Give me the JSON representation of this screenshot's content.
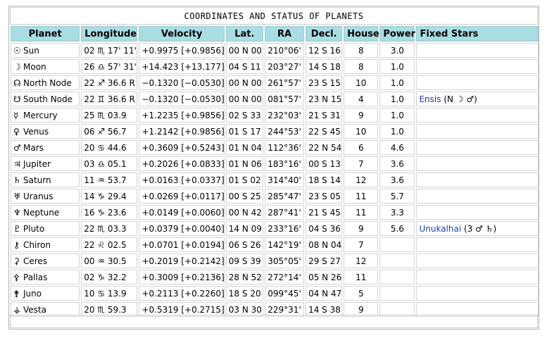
{
  "title": "COORDINATES AND STATUS OF PLANETS",
  "headers": [
    "Planet",
    "Longitude",
    "Velocity",
    "Lat.",
    "RA",
    "Decl.",
    "House",
    "Power",
    "Fixed Stars"
  ],
  "rows": [
    {
      "glyph": "☉",
      "name": "Sun",
      "lon": "02 ♏ 17' 11\"",
      "vel": "+0.9975  [+0.9856]",
      "lat": "00 N 00",
      "ra": "210°06'",
      "decl": "12 S 16",
      "house": "8",
      "power": "3.0",
      "star": "",
      "star_detail": ""
    },
    {
      "glyph": "☽",
      "name": "Moon",
      "lon": "26 ♎ 57' 31\"",
      "vel": "+14.423  [+13.177]",
      "lat": "04 S 11",
      "ra": "203°27'",
      "decl": "14 S 18",
      "house": "8",
      "power": "1.0",
      "star": "",
      "star_detail": ""
    },
    {
      "glyph": "☊",
      "name": "North Node",
      "lon": "22 ♐ 36.6  R",
      "vel": "−0.1320  [−0.0530]",
      "lat": "00 N 00",
      "ra": "261°57'",
      "decl": "23 S 15",
      "house": "10",
      "power": "1.0",
      "star": "",
      "star_detail": ""
    },
    {
      "glyph": "☋",
      "name": "South Node",
      "lon": "22 ♊ 36.6  R",
      "vel": "−0.1320  [−0.0530]",
      "lat": "00 N 00",
      "ra": "081°57'",
      "decl": "23 N 15",
      "house": "4",
      "power": "1.0",
      "star": "Ensis",
      "star_detail": " (N ☽ ♂)"
    },
    {
      "glyph": "☿",
      "name": "Mercury",
      "lon": "25 ♏ 03.9",
      "vel": "+1.2235  [+0.9856]",
      "lat": "02 S 33",
      "ra": "232°03'",
      "decl": "21 S 31",
      "house": "9",
      "power": "1.0",
      "star": "",
      "star_detail": ""
    },
    {
      "glyph": "♀",
      "name": "Venus",
      "lon": "06 ♐ 56.7",
      "vel": "+1.2142  [+0.9856]",
      "lat": "01 S 17",
      "ra": "244°53'",
      "decl": "22 S 45",
      "house": "10",
      "power": "1.0",
      "star": "",
      "star_detail": ""
    },
    {
      "glyph": "♂",
      "name": "Mars",
      "lon": "20 ♋ 44.6",
      "vel": "+0.3609  [+0.5243]",
      "lat": "01 N 04",
      "ra": "112°36'",
      "decl": "22 N 54",
      "house": "6",
      "power": "4.6",
      "star": "",
      "star_detail": ""
    },
    {
      "glyph": "♃",
      "name": "Jupiter",
      "lon": "03 ♎ 05.1",
      "vel": "+0.2026  [+0.0833]",
      "lat": "01 N 06",
      "ra": "183°16'",
      "decl": "00 S 13",
      "house": "7",
      "power": "3.6",
      "star": "",
      "star_detail": ""
    },
    {
      "glyph": "♄",
      "name": "Saturn",
      "lon": "11 ♒ 53.7",
      "vel": "+0.0163  [+0.0337]",
      "lat": "01 S 02",
      "ra": "314°40'",
      "decl": "18 S 14",
      "house": "12",
      "power": "3.6",
      "star": "",
      "star_detail": ""
    },
    {
      "glyph": "♅",
      "name": "Uranus",
      "lon": "14 ♑ 29.4",
      "vel": "+0.0269  [+0.0117]",
      "lat": "00 S 25",
      "ra": "285°47'",
      "decl": "23 S 05",
      "house": "11",
      "power": "5.7",
      "star": "",
      "star_detail": ""
    },
    {
      "glyph": "♆",
      "name": "Neptune",
      "lon": "16 ♑ 23.6",
      "vel": "+0.0149  [+0.0060]",
      "lat": "00 N 42",
      "ra": "287°41'",
      "decl": "21 S 45",
      "house": "11",
      "power": "3.3",
      "star": "",
      "star_detail": ""
    },
    {
      "glyph": "♇",
      "name": "Pluto",
      "lon": "22 ♏ 03.3",
      "vel": "+0.0379  [+0.0040]",
      "lat": "14 N 09",
      "ra": "233°16'",
      "decl": "04 S 36",
      "house": "9",
      "power": "5.6",
      "star": "Unukalhai",
      "star_detail": " (3 ♂ ♄)"
    },
    {
      "glyph": "⚷",
      "name": "Chiron",
      "lon": "22 ♌ 02.5",
      "vel": "+0.0701  [+0.0194]",
      "lat": "06 S 26",
      "ra": "142°19'",
      "decl": "08 N 04",
      "house": "7",
      "power": "",
      "star": "",
      "star_detail": ""
    },
    {
      "glyph": "⚳",
      "name": "Ceres",
      "lon": "00 ♒ 30.5",
      "vel": "+0.2019  [+0.2142]",
      "lat": "09 S 39",
      "ra": "305°05'",
      "decl": "29 S 27",
      "house": "12",
      "power": "",
      "star": "",
      "star_detail": ""
    },
    {
      "glyph": "⚴",
      "name": "Pallas",
      "lon": "02 ♑ 32.2",
      "vel": "+0.3009  [+0.2136]",
      "lat": "28 N 52",
      "ra": "272°14'",
      "decl": "05 N 26",
      "house": "11",
      "power": "",
      "star": "",
      "star_detail": ""
    },
    {
      "glyph": "⚵",
      "name": "Juno",
      "lon": "10 ♋ 13.9",
      "vel": "+0.2113  [+0.2260]",
      "lat": "18 S 20",
      "ra": "099°45'",
      "decl": "04 N 47",
      "house": "5",
      "power": "",
      "star": "",
      "star_detail": ""
    },
    {
      "glyph": "⚶",
      "name": "Vesta",
      "lon": "20 ♏ 59.3",
      "vel": "+0.5319  [+0.2715]",
      "lat": "03 N 30",
      "ra": "229°31'",
      "decl": "14 S 38",
      "house": "9",
      "power": "",
      "star": "",
      "star_detail": ""
    }
  ]
}
